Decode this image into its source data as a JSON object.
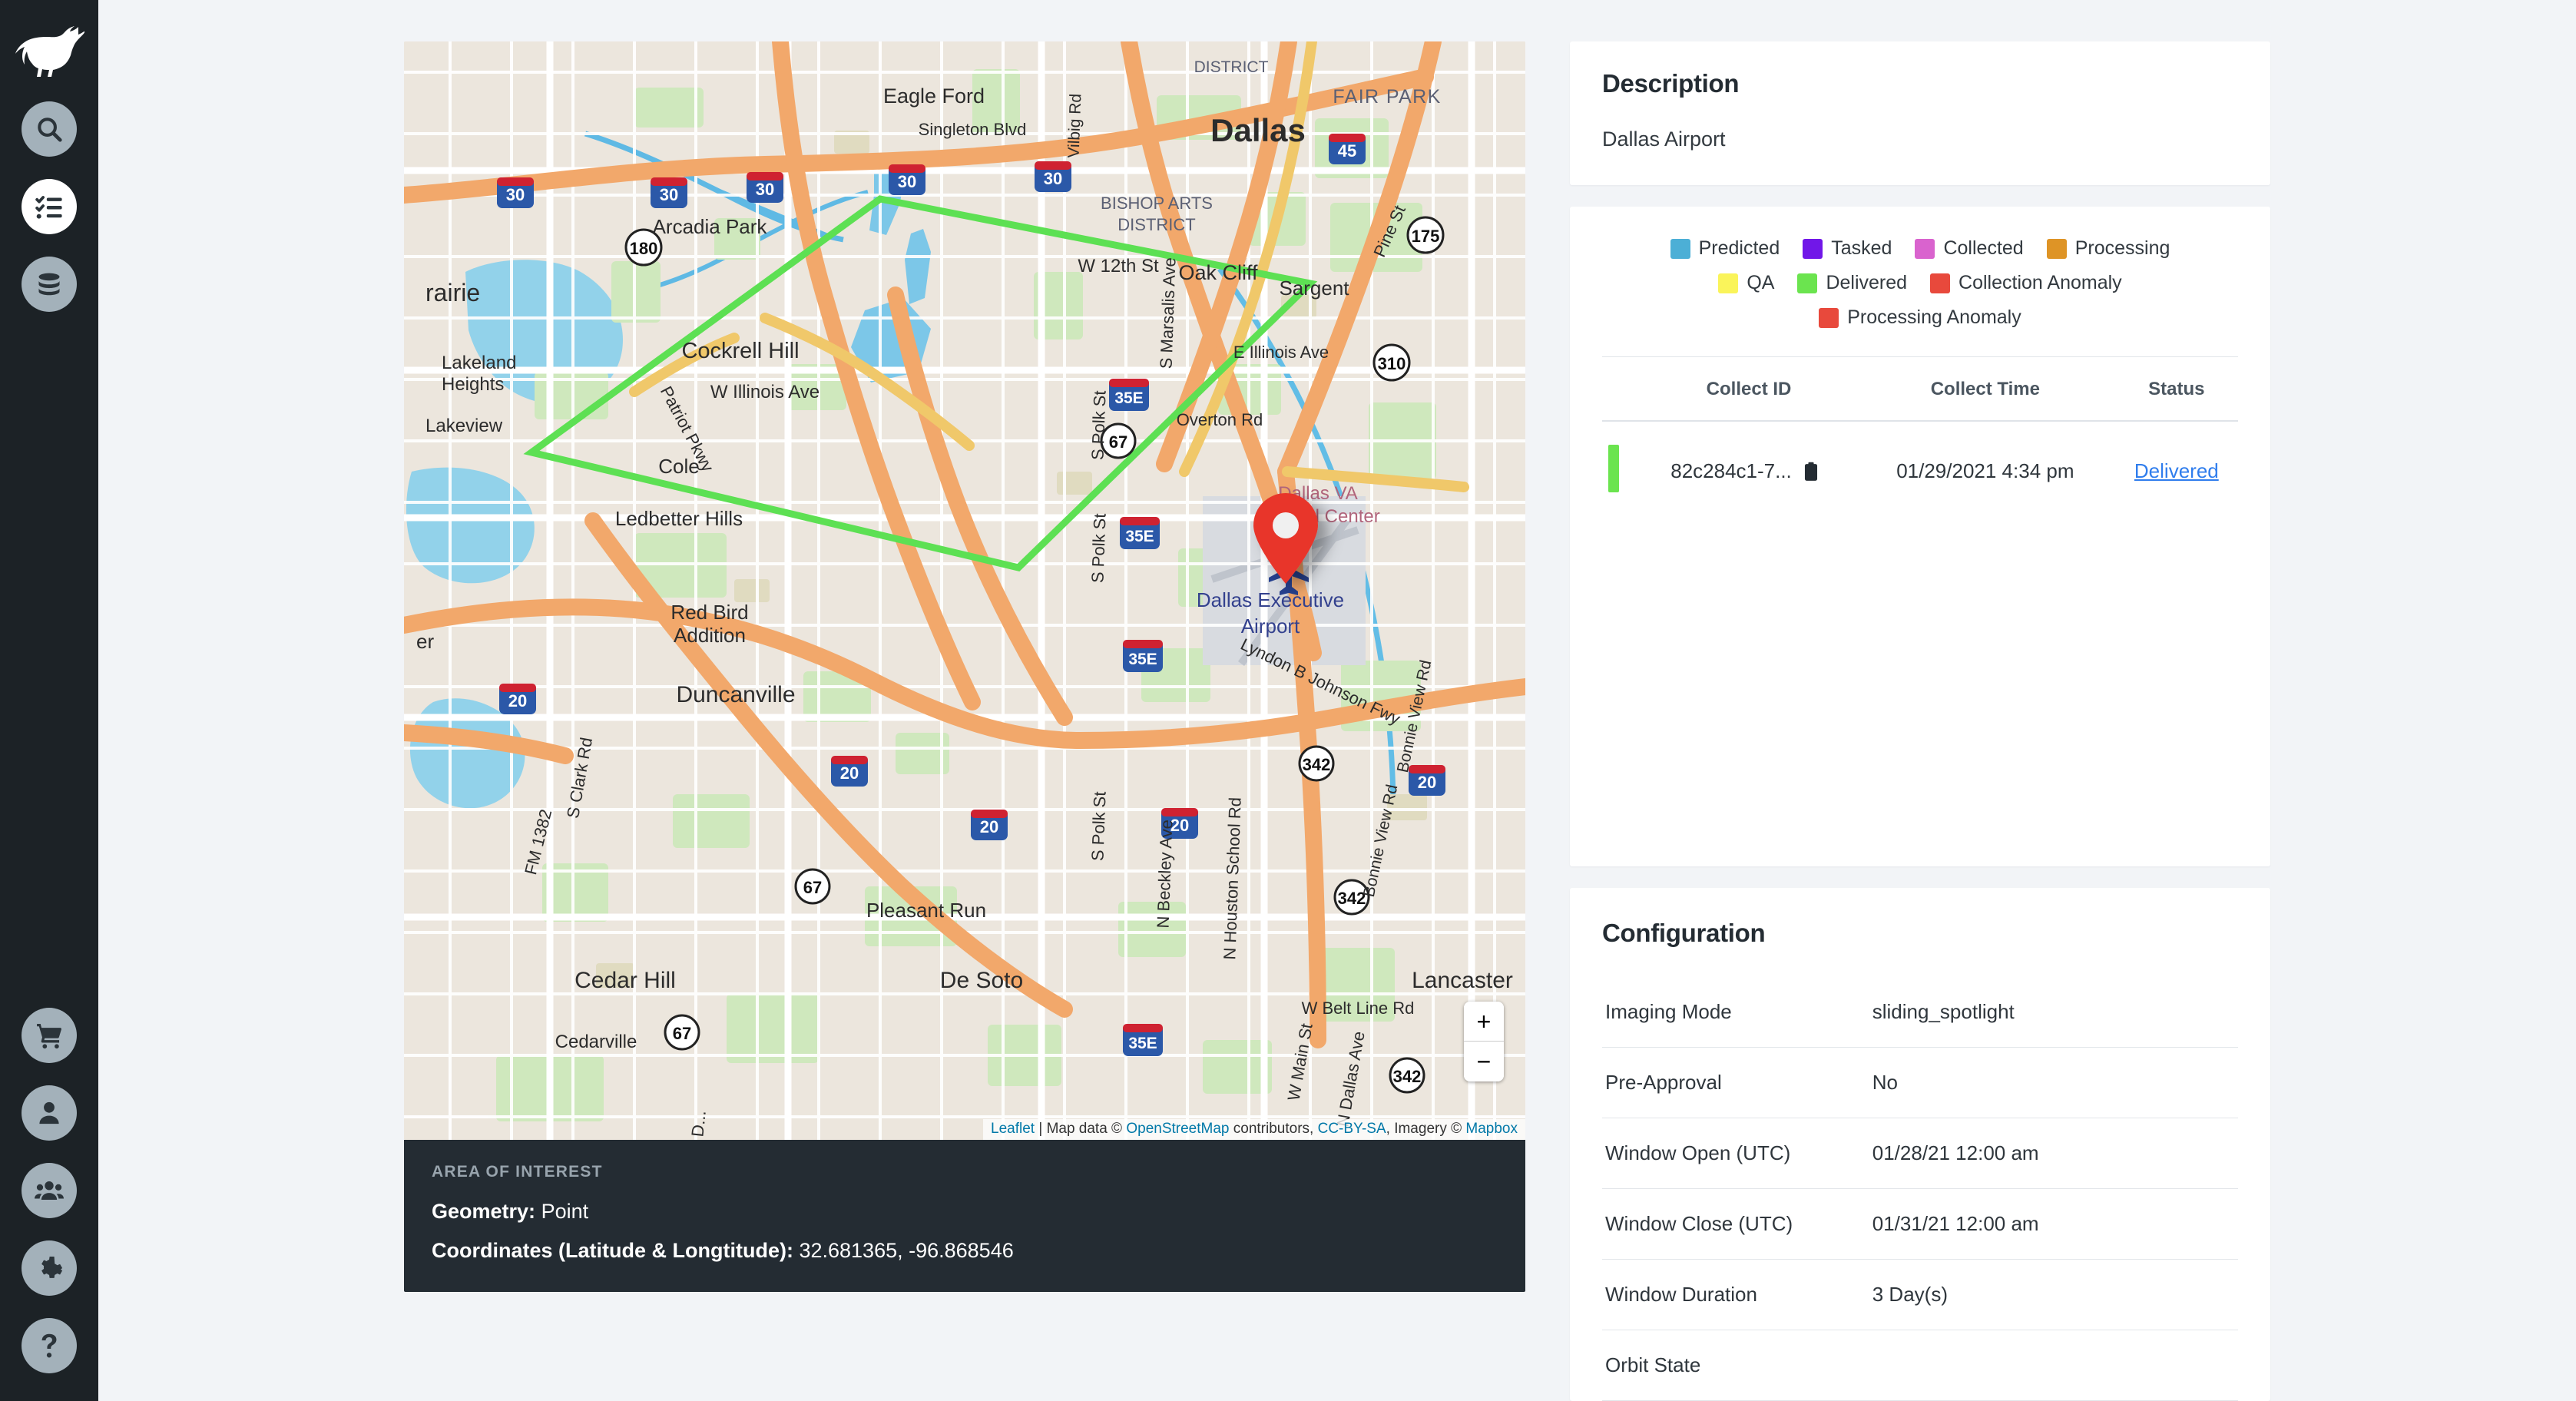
{
  "sidebar": {
    "logo": "gazelle-logo",
    "top_items": [
      {
        "name": "search",
        "icon": "search-icon",
        "active": false
      },
      {
        "name": "tasks",
        "icon": "task-list-icon",
        "active": true
      },
      {
        "name": "archive",
        "icon": "database-icon",
        "active": false
      }
    ],
    "bottom_items": [
      {
        "name": "cart",
        "icon": "shopping-cart-icon"
      },
      {
        "name": "account",
        "icon": "user-icon"
      },
      {
        "name": "team",
        "icon": "users-icon"
      },
      {
        "name": "settings",
        "icon": "gear-icon"
      },
      {
        "name": "help",
        "icon": "question-mark-icon"
      }
    ]
  },
  "map": {
    "zoom_in_label": "+",
    "zoom_out_label": "−",
    "attribution": {
      "leaflet": "Leaflet",
      "separator": " | ",
      "prefix": "Map data © ",
      "osm": "OpenStreetMap",
      "middle": " contributors, ",
      "license": "CC-BY-SA",
      "imagery_prefix": ", Imagery © ",
      "mapbox": "Mapbox"
    },
    "marker": {
      "name": "location-pin",
      "color": "#E8342A"
    },
    "footprint_color": "#5DE053",
    "place_labels": [
      "Eagle Ford",
      "Singleton Blvd",
      "Vilbig Rd",
      "Dallas",
      "FAIR PARK",
      "Arcadia Park",
      "BISHOP ARTS DISTRICT",
      "W 12th St",
      "Oak Cliff",
      "Sargent",
      "Pine St",
      "Cockrell Hill",
      "S Marsalis Ave",
      "E Illinois Ave",
      "Lakeland Heights",
      "W Illinois Ave",
      "Patriot Pkwy",
      "Cole",
      "Lakeview",
      "S Polk St",
      "Overton Rd",
      "Ledbetter Hills",
      "Dallas VA Medical Center",
      "Red Bird Addition",
      "Dallas Executive Airport",
      "Duncanville",
      "Lyndon B Johnson Fwy",
      "S Clark Rd",
      "S Polk St",
      "N Beckley Ave",
      "N Houston School Rd",
      "Bonnie View Rd",
      "FM 1382",
      "Pleasant Run",
      "Cedar Hill",
      "De Soto",
      "Lancaster",
      "W Belt Line Rd",
      "W Main St",
      "N Dallas Ave",
      "Cedarville",
      "rairie"
    ],
    "shield_labels": [
      "30",
      "30",
      "30",
      "30",
      "180",
      "35E",
      "35E",
      "35E",
      "35E",
      "67",
      "67",
      "67",
      "45",
      "175",
      "310",
      "20",
      "20",
      "20",
      "20",
      "342",
      "342",
      "342"
    ]
  },
  "aoi": {
    "title": "AREA OF INTEREST",
    "geometry_label": "Geometry:",
    "geometry_value": "Point",
    "coordinates_label": "Coordinates (Latitude & Longtitude):",
    "coordinates_value": "32.681365, -96.868546"
  },
  "description": {
    "title": "Description",
    "text": "Dallas Airport"
  },
  "collects": {
    "legend": {
      "row1": [
        {
          "label": "Predicted",
          "color": "#4CAFD6"
        },
        {
          "label": "Tasked",
          "color": "#7117E8"
        },
        {
          "label": "Collected",
          "color": "#D963CE"
        },
        {
          "label": "Processing",
          "color": "#DE9426"
        }
      ],
      "row2": [
        {
          "label": "QA",
          "color": "#FAF45A"
        },
        {
          "label": "Delivered",
          "color": "#6BE44F"
        },
        {
          "label": "Collection Anomaly",
          "color": "#E8493C"
        }
      ],
      "row3": [
        {
          "label": "Processing Anomaly",
          "color": "#E8493C"
        }
      ]
    },
    "columns": [
      "Collect ID",
      "Collect Time",
      "Status"
    ],
    "rows": [
      {
        "bar_color": "#6BE44F",
        "collect_id": "82c284c1-7...",
        "copy_icon": "clipboard-icon",
        "collect_time": "01/29/2021 4:34 pm",
        "status": "Delivered"
      }
    ]
  },
  "configuration": {
    "title": "Configuration",
    "rows": [
      {
        "key": "Imaging Mode",
        "value": "sliding_spotlight"
      },
      {
        "key": "Pre-Approval",
        "value": "No"
      },
      {
        "key": "Window Open (UTC)",
        "value": "01/28/21 12:00 am"
      },
      {
        "key": "Window Close (UTC)",
        "value": "01/31/21 12:00 am"
      },
      {
        "key": "Window Duration",
        "value": "3 Day(s)"
      },
      {
        "key": "Orbit State",
        "value": ""
      }
    ]
  }
}
